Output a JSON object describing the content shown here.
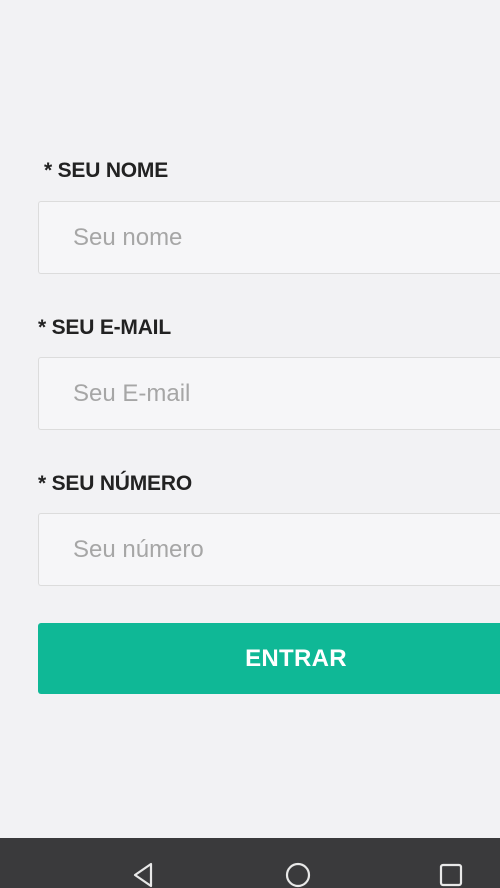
{
  "form": {
    "name": {
      "label": "* SEU NOME",
      "placeholder": "Seu nome"
    },
    "email": {
      "label": "* SEU E-MAIL",
      "placeholder": "Seu E-mail"
    },
    "number": {
      "label": "* SEU NÚMERO",
      "placeholder": "Seu número"
    },
    "submit_label": "ENTRAR"
  },
  "colors": {
    "background": "#f2f2f4",
    "accent": "#0fb896",
    "nav_bar": "#3a3a3c"
  },
  "nav_bar": {
    "icons": [
      "back-triangle-icon",
      "home-circle-icon",
      "recent-apps-square-icon"
    ]
  }
}
